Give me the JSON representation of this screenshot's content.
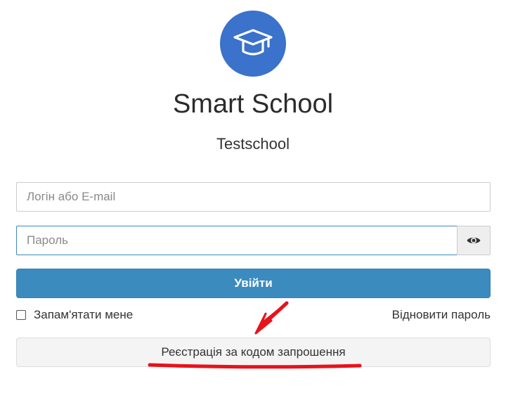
{
  "app": {
    "title": "Smart School",
    "school_name": "Testschool",
    "logo_icon": "graduation-cap-icon",
    "brand_color": "#3a72cc"
  },
  "form": {
    "login_placeholder": "Логін або E-mail",
    "login_value": "",
    "password_placeholder": "Пароль",
    "password_value": "",
    "show_password_icon": "eye-icon",
    "submit_label": "Увійти",
    "submit_color": "#3b8bbf",
    "remember_label": "Запам'ятати мене",
    "remember_checked": false,
    "forgot_label": "Відновити пароль",
    "register_label": "Реєстрація за кодом запрошення"
  },
  "annotation": {
    "arrow_color": "#e8121b"
  }
}
